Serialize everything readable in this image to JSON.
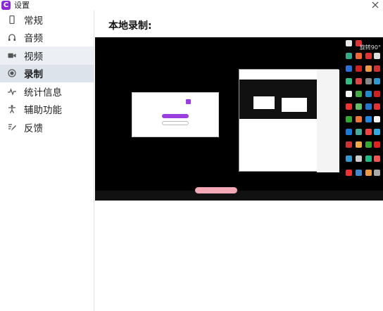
{
  "window": {
    "title": "设置",
    "app_icon_letter": "C"
  },
  "sidebar": {
    "items": [
      {
        "label": "常规",
        "icon": "phone-icon"
      },
      {
        "label": "音频",
        "icon": "headphones-icon"
      },
      {
        "label": "视频",
        "icon": "camera-icon"
      },
      {
        "label": "录制",
        "icon": "record-icon"
      },
      {
        "label": "统计信息",
        "icon": "pulse-icon"
      },
      {
        "label": "辅助功能",
        "icon": "accessibility-icon"
      },
      {
        "label": "反馈",
        "icon": "feedback-icon"
      }
    ],
    "active_index": 3
  },
  "main": {
    "section_title": "本地录制:",
    "preview_corner_label": "旋转90°"
  },
  "colors": {
    "brand": "#8a2bd6",
    "active_nav_bg": "#dde3ea",
    "preview_bg": "#000000"
  }
}
